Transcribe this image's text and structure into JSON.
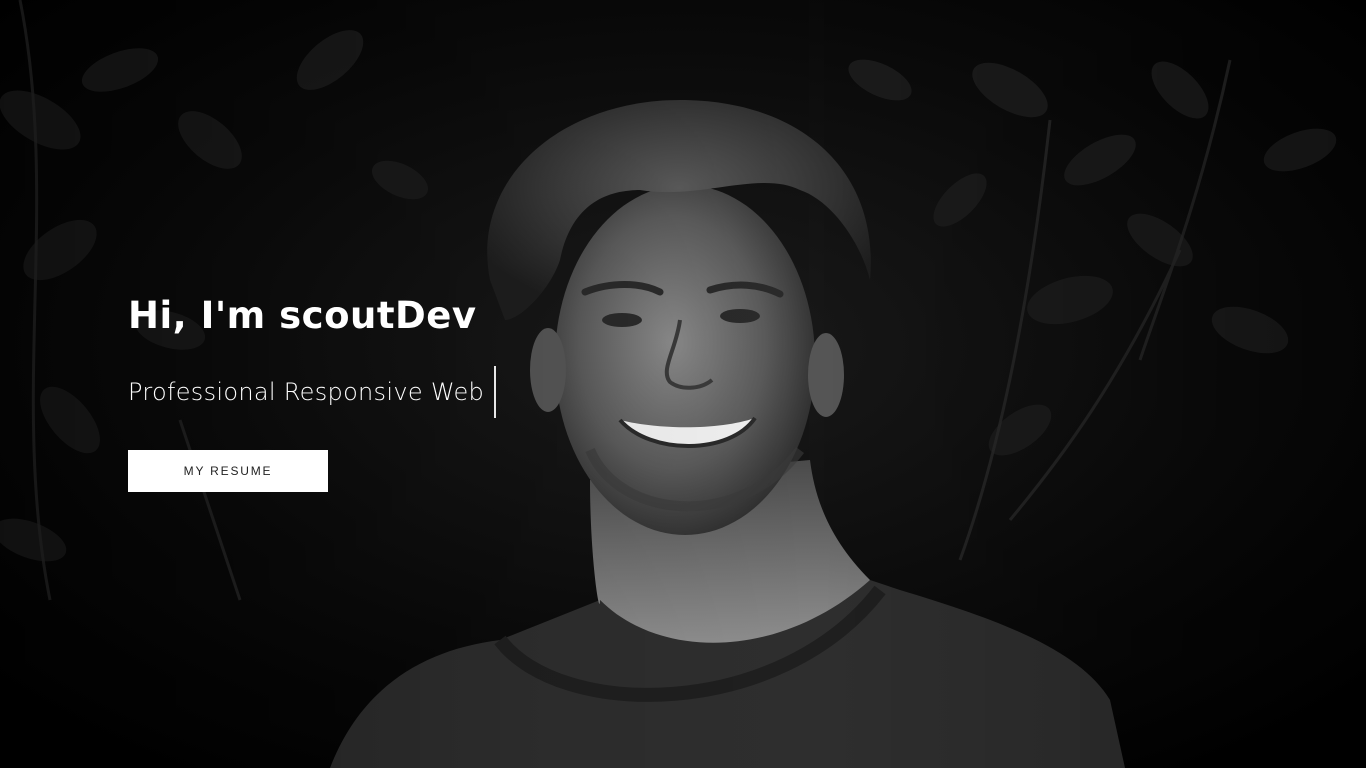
{
  "hero": {
    "title": "Hi, I'm scoutDev",
    "subtitle": "Professional Responsive Web",
    "resume_button_label": "MY RESUME"
  },
  "colors": {
    "background": "#000000",
    "text": "#ffffff",
    "button_background": "#ffffff",
    "button_text": "#222222"
  }
}
